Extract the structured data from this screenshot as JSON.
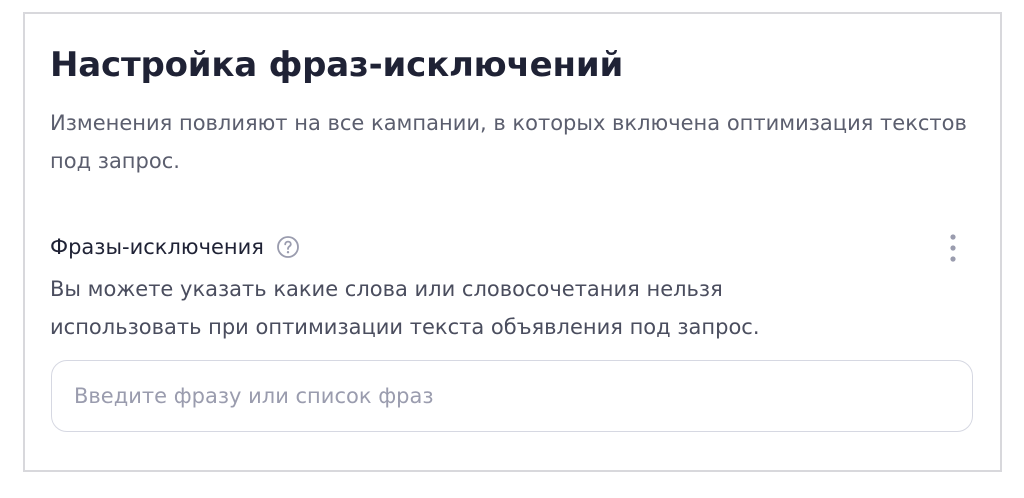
{
  "panel": {
    "title": "Настройка фраз-исключений",
    "subtitle": "Изменения повлияют на все кампании, в которых включена оптимизация текстов под запрос."
  },
  "exclusions": {
    "label": "Фразы-исключения",
    "help_icon": "question-circle-icon",
    "menu_icon": "vertical-ellipsis-icon",
    "description": "Вы можете указать какие слова или словосочетания нельзя использовать при оптимизации текста объявления под запрос.",
    "input_value": "",
    "input_placeholder": "Введите фразу или список фраз"
  },
  "colors": {
    "title": "#1f2235",
    "secondary_text": "#5b5e6e",
    "icon": "#9a9cae",
    "border": "#d6d8e2"
  }
}
